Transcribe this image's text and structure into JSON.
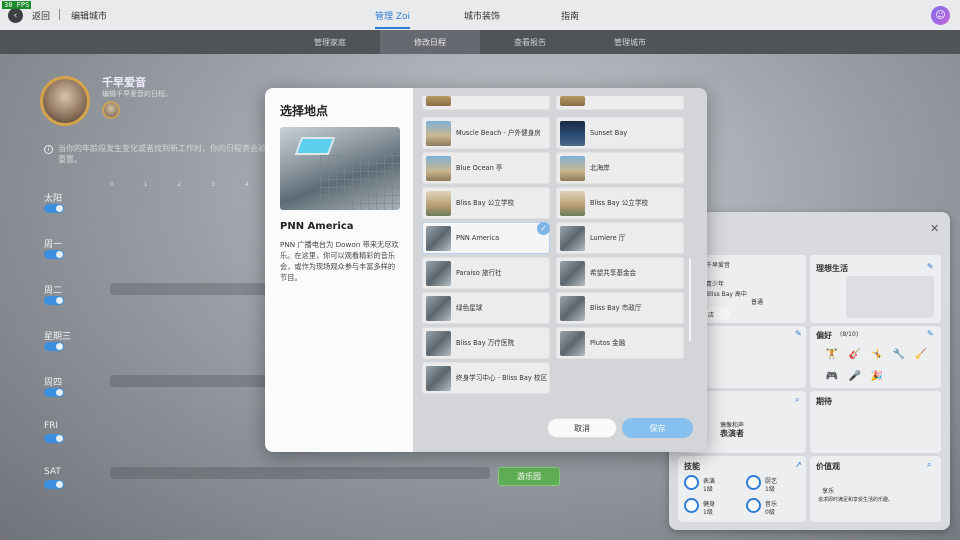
{
  "fps": "30 FPS",
  "topbar": {
    "back_label": "返回",
    "breadcrumb": "编辑城市",
    "tabs": [
      "管理 Zoi",
      "城市装饰",
      "指南"
    ]
  },
  "subbar": {
    "tabs": [
      "管理家庭",
      "修改日程",
      "查看报告",
      "管理城市"
    ]
  },
  "character": {
    "name": "千早爱音",
    "subtitle": "编辑千早爱音的日程。",
    "info": "当你的年龄段发生变化或者找到新工作时，你的日程表会被重置。"
  },
  "schedule": {
    "days": [
      "太阳",
      "周一",
      "周二",
      "星期三",
      "周四",
      "FRI",
      "SAT"
    ],
    "hours": "0 1 2 3 4 5 6",
    "park_button": "游乐园"
  },
  "right_panel": {
    "stats_lines": [
      "千早爱音",
      "青少年",
      "Bliss Bay 高中",
      "普通"
    ],
    "shop_label": "店",
    "ideal_life": "理想生活",
    "preference": "偏好",
    "preference_count": "(8/10)",
    "job_small": "偶像和声",
    "job": "表演者",
    "expect": "期待",
    "skills": "技能",
    "skill_items": [
      {
        "name": "表演",
        "level": "1级"
      },
      {
        "name": "厨艺",
        "level": "1级"
      },
      {
        "name": "健身",
        "level": "1级"
      },
      {
        "name": "音乐",
        "level": "0级"
      }
    ],
    "values": "价值观",
    "value_item": "享乐",
    "value_desc": "追求即时满足和享受生活的乐趣。"
  },
  "modal": {
    "title": "选择地点",
    "selected": {
      "name": "PNN America",
      "description": "PNN 广播电台为 Dowon 带来无尽欢乐。在这里，你可以观看精彩的音乐会，或作为现场观众参与丰富多样的节目。"
    },
    "locations": [
      {
        "label": "Muscle Beach - 户外健身房",
        "style": "beach"
      },
      {
        "label": "Sunset Bay",
        "style": "night"
      },
      {
        "label": "Blue Ocean 亭",
        "style": "beach"
      },
      {
        "label": "北海岸",
        "style": "beach"
      },
      {
        "label": "Bliss Bay 公立学校",
        "style": "school"
      },
      {
        "label": "Bliss Bay 公立学校",
        "style": "school"
      },
      {
        "label": "PNN America",
        "style": "city"
      },
      {
        "label": "Lumiere 厅",
        "style": "city"
      },
      {
        "label": "Paraiso 旅行社",
        "style": "city"
      },
      {
        "label": "希望共享基金会",
        "style": "city"
      },
      {
        "label": "绿色星球",
        "style": "city"
      },
      {
        "label": "Bliss Bay 市政厅",
        "style": "city"
      },
      {
        "label": "Bliss Bay 万疗医院",
        "style": "city"
      },
      {
        "label": "Plutos 金融",
        "style": "city"
      },
      {
        "label": "终身学习中心 - Bliss Bay 校区",
        "style": "city"
      }
    ],
    "cancel_label": "取消",
    "save_label": "保存"
  },
  "colors": {
    "accent": "#2e7bd6",
    "save": "#86c0ef",
    "park": "#5fae55"
  }
}
